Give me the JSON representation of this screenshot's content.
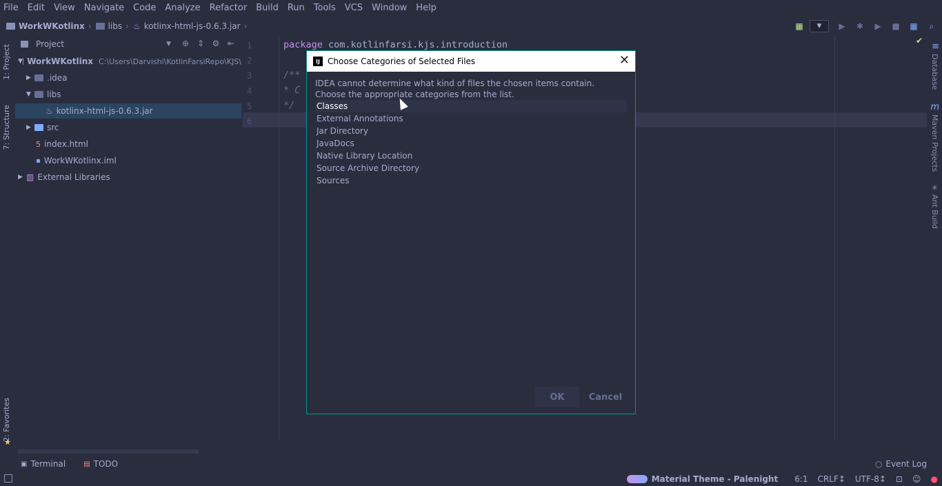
{
  "menu": [
    "File",
    "Edit",
    "View",
    "Navigate",
    "Code",
    "Analyze",
    "Refactor",
    "Build",
    "Run",
    "Tools",
    "VCS",
    "Window",
    "Help"
  ],
  "breadcrumb": {
    "project": "WorkWKotlinx",
    "folder": "libs",
    "file": "kotlinx-html-js-0.6.3.jar"
  },
  "left_tabs": {
    "project": "1: Project",
    "structure": "7: Structure",
    "favorites": "2: Favorites"
  },
  "right_tabs": {
    "database": "Database",
    "maven": "Maven Projects",
    "ant": "Ant Build"
  },
  "project_panel": {
    "title": "Project",
    "tree": [
      {
        "label": "WorkWKotlinx",
        "path": "C:\\Users\\Darvishi\\KotlinFarsiRepo\\KJS\\"
      },
      {
        "label": ".idea"
      },
      {
        "label": "libs"
      },
      {
        "label": "kotlinx-html-js-0.6.3.jar"
      },
      {
        "label": "src"
      },
      {
        "label": "index.html"
      },
      {
        "label": "WorkWKotlinx.iml"
      },
      {
        "label": "External Libraries"
      }
    ]
  },
  "editor": {
    "line_numbers": [
      "1",
      "2",
      "3",
      "4",
      "5",
      "6"
    ],
    "line1_kw": "package",
    "line1_pkg": "com.kotlinfarsi.kjs.introduction",
    "line3": "/**",
    "line4": " * C",
    "line5": " */"
  },
  "dialog": {
    "title": "Choose Categories of Selected Files",
    "message_line1": "IDEA cannot determine what kind of files the chosen items contain.",
    "message_line2": "Choose the appropriate categories from the list.",
    "categories": [
      "Classes",
      "External Annotations",
      "Jar Directory",
      "JavaDocs",
      "Native Library Location",
      "Source Archive Directory",
      "Sources"
    ],
    "ok_label": "OK",
    "cancel_label": "Cancel"
  },
  "bottom_tools": {
    "terminal": "Terminal",
    "todo": "TODO",
    "event_log": "Event Log"
  },
  "status": {
    "theme": "Material Theme - Palenight",
    "position": "6:1",
    "line_sep": "CRLF↕",
    "encoding": "UTF-8↕"
  }
}
